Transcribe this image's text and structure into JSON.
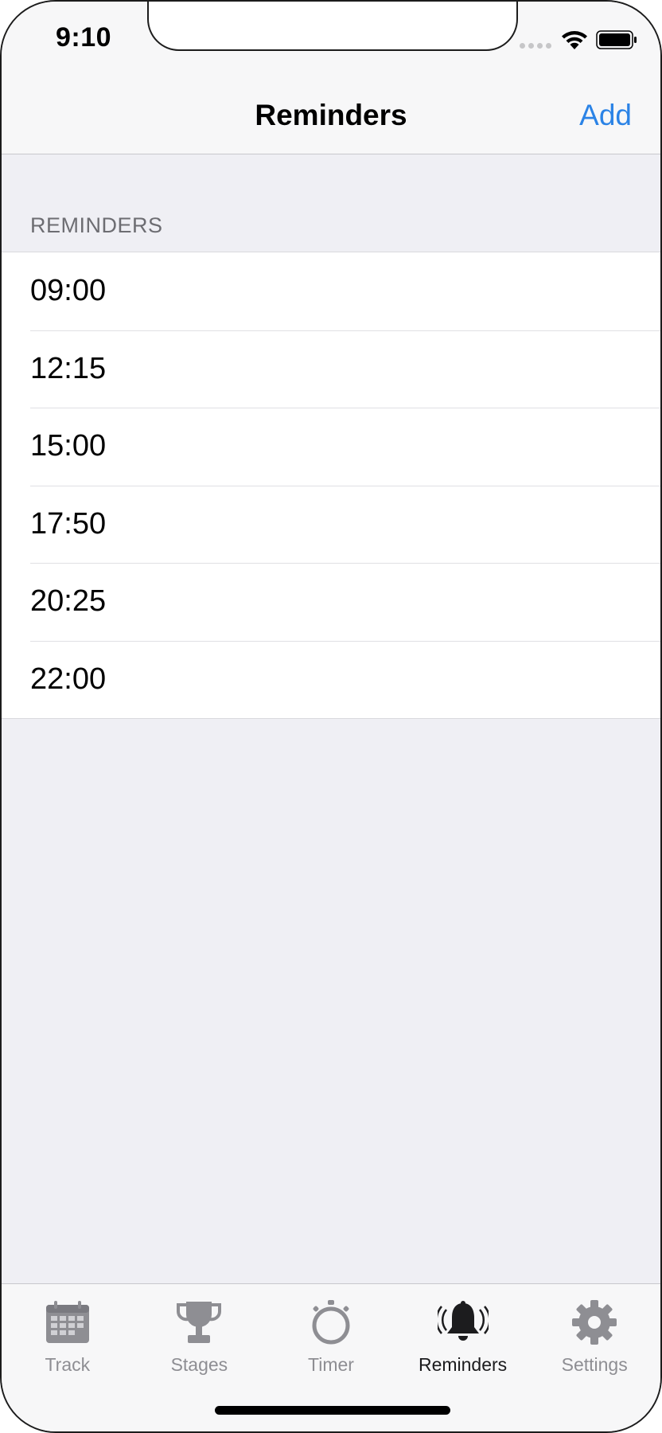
{
  "status_bar": {
    "time": "9:10",
    "icons": [
      "signal-dots-icon",
      "wifi-icon",
      "battery-icon"
    ]
  },
  "nav": {
    "title": "Reminders",
    "add_label": "Add"
  },
  "section": {
    "header": "REMINDERS"
  },
  "reminders": [
    "09:00",
    "12:15",
    "15:00",
    "17:50",
    "20:25",
    "22:00"
  ],
  "tabs": [
    {
      "label": "Track",
      "icon": "calendar-icon",
      "active": false
    },
    {
      "label": "Stages",
      "icon": "trophy-icon",
      "active": false
    },
    {
      "label": "Timer",
      "icon": "stopwatch-icon",
      "active": false
    },
    {
      "label": "Reminders",
      "icon": "bell-ringing-icon",
      "active": true
    },
    {
      "label": "Settings",
      "icon": "gear-icon",
      "active": false
    }
  ],
  "colors": {
    "accent": "#2b83e6",
    "background": "#efeff4",
    "bar": "#f7f7f8",
    "inactive_tab": "#8e8e93",
    "active_tab": "#1c1c1e"
  }
}
